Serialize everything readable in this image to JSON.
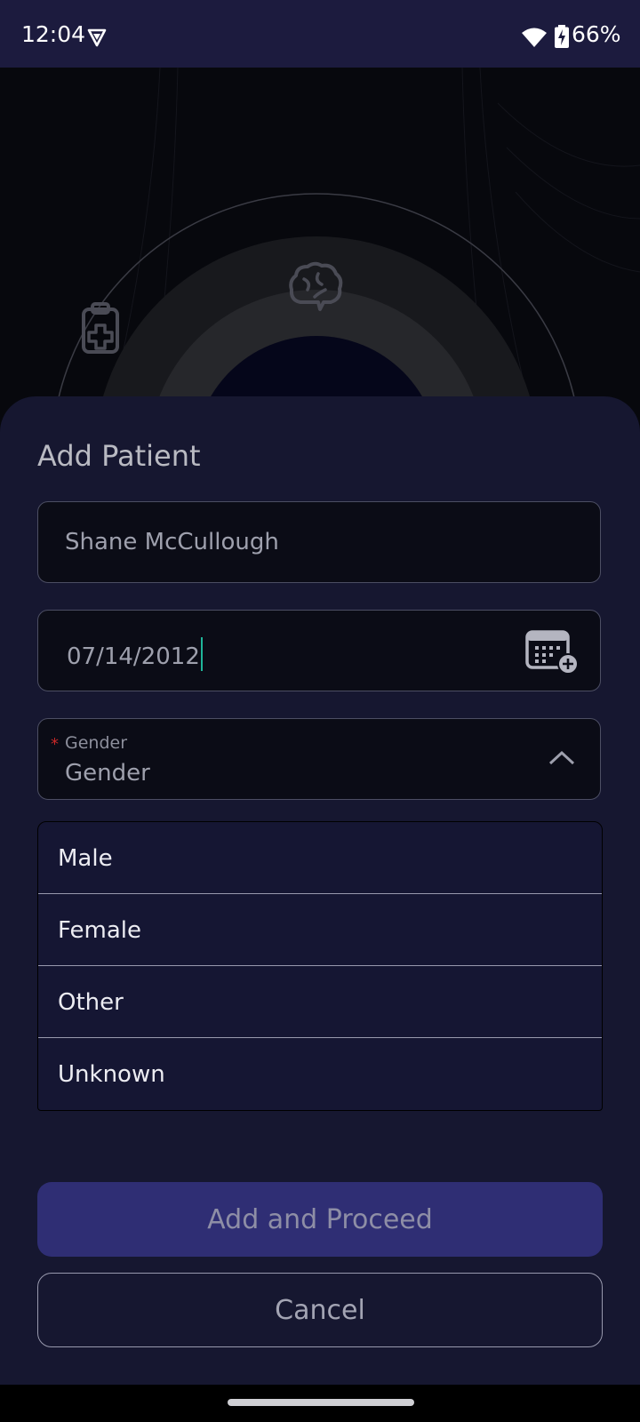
{
  "status_bar": {
    "time": "12:04",
    "battery_percent": "66%"
  },
  "background": {
    "icons": [
      "clipboard-medical-icon",
      "brain-icon"
    ]
  },
  "sheet": {
    "title": "Add Patient",
    "name_field": {
      "value": "Shane McCullough"
    },
    "dob_field": {
      "value": "07/14/2012",
      "icon": "calendar-add-icon"
    },
    "gender_field": {
      "required_marker": "*",
      "label": "Gender",
      "value": "Gender",
      "icon": "chevron-up-icon"
    },
    "gender_options": [
      "Male",
      "Female",
      "Other",
      "Unknown"
    ],
    "primary_button": "Add and Proceed",
    "cancel_button": "Cancel"
  },
  "colors": {
    "status_bar_bg": "#1c1b3e",
    "sheet_bg": "#161730",
    "primary_button_bg": "#2f2e74",
    "cursor": "#1fb59a",
    "required": "#c62828"
  }
}
